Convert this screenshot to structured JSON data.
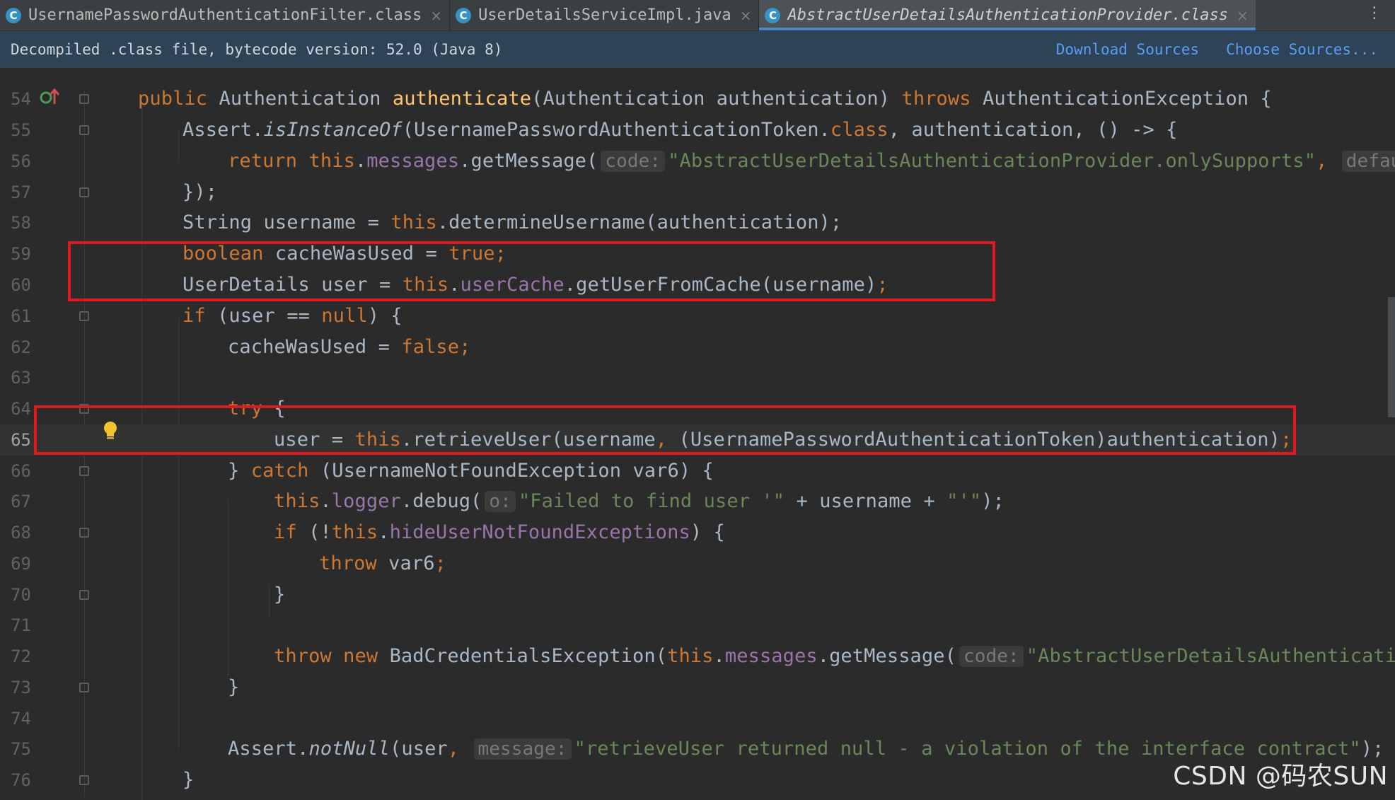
{
  "tabs": [
    {
      "icon": "C",
      "label": "UsernamePasswordAuthenticationFilter.class",
      "close": "×"
    },
    {
      "icon": "C",
      "label": "UserDetailsServiceImpl.java",
      "close": "×"
    },
    {
      "icon": "C",
      "label": "AbstractUserDetailsAuthenticationProvider.class",
      "close": "×"
    }
  ],
  "tabbar_more": "⋮",
  "banner": {
    "text": "Decompiled .class file, bytecode version: 52.0 (Java 8)",
    "download_sources": "Download Sources",
    "choose_sources": "Choose Sources..."
  },
  "editor": {
    "current_line": "65",
    "lines": [
      {
        "n": "54"
      },
      {
        "n": "55"
      },
      {
        "n": "56"
      },
      {
        "n": "57"
      },
      {
        "n": "58"
      },
      {
        "n": "59"
      },
      {
        "n": "60"
      },
      {
        "n": "61"
      },
      {
        "n": "62"
      },
      {
        "n": "63"
      },
      {
        "n": "64"
      },
      {
        "n": "65"
      },
      {
        "n": "66"
      },
      {
        "n": "67"
      },
      {
        "n": "68"
      },
      {
        "n": "69"
      },
      {
        "n": "70"
      },
      {
        "n": "71"
      },
      {
        "n": "72"
      },
      {
        "n": "73"
      },
      {
        "n": "74"
      },
      {
        "n": "75"
      },
      {
        "n": "76"
      }
    ],
    "code": {
      "l54": {
        "t1": "public ",
        "t2": "Authentication ",
        "t3": "authenticate",
        "t4": "(Authentication authentication) ",
        "t5": "throws ",
        "t6": "AuthenticationException {"
      },
      "l55": {
        "t1": "Assert.",
        "t2": "isInstanceOf",
        "t3": "(UsernamePasswordAuthenticationToken.",
        "t4": "class",
        "t5": ", authentication, () -> {"
      },
      "l56": {
        "t1": "return ",
        "t2": "this",
        "t3": ".",
        "t4": "messages",
        "t5": ".getMessage(",
        "hint1": "code:",
        "t6": "\"AbstractUserDetailsAuthenticationProvider.onlySupports\"",
        "t7": ", ",
        "hint2": "defaul"
      },
      "l57": {
        "t1": "});"
      },
      "l58": {
        "t1": "String username = ",
        "t2": "this",
        "t3": ".determineUsername(authentication);"
      },
      "l59": {
        "t1": "boolean ",
        "t2": "cacheWasUsed = ",
        "t3": "true",
        "t4": ";"
      },
      "l60": {
        "t1": "UserDetails user = ",
        "t2": "this",
        "t3": ".",
        "t4": "userCache",
        "t5": ".getUserFromCache(username)",
        "t6": ";"
      },
      "l61": {
        "t1": "if ",
        "t2": "(user == ",
        "t3": "null",
        "t4": ") {"
      },
      "l62": {
        "t1": "cacheWasUsed = ",
        "t2": "false",
        "t3": ";"
      },
      "l64": {
        "t1": "try ",
        "t2": "{"
      },
      "l65": {
        "t1": "user = ",
        "t2": "this",
        "t3": ".retrieveUser(username",
        "t4": ", ",
        "t5": "(UsernamePasswordAuthenticationToken)authentication)",
        "t6": ";"
      },
      "l66": {
        "t1": "} ",
        "t2": "catch ",
        "t3": "(UsernameNotFoundException var6) {"
      },
      "l67": {
        "t1": "this",
        "t2": ".",
        "t3": "logger",
        "t4": ".debug(",
        "hint1": "o:",
        "t5": "\"Failed to find user '\"",
        "t6": " + username + ",
        "t7": "\"'\"",
        "t8": ");"
      },
      "l68": {
        "t1": "if ",
        "t2": "(!",
        "t3": "this",
        "t4": ".",
        "t5": "hideUserNotFoundExceptions",
        "t6": ") {"
      },
      "l69": {
        "t1": "throw ",
        "t2": "var6",
        "t3": ";"
      },
      "l70": {
        "t1": "}"
      },
      "l72": {
        "t1": "throw new ",
        "t2": "BadCredentialsException(",
        "t3": "this",
        "t4": ".",
        "t5": "messages",
        "t6": ".getMessage(",
        "hint1": "code:",
        "t7": "\"AbstractUserDetailsAuthenticatio"
      },
      "l73": {
        "t1": "}"
      },
      "l75": {
        "t1": "Assert.",
        "t2": "notNull",
        "t3": "(user",
        "t4": ", ",
        "hint1": "message:",
        "t5": "\"retrieveUser returned null - a violation of the interface contract\"",
        "t6": ");"
      },
      "l76": {
        "t1": "}"
      }
    }
  },
  "watermark": "CSDN @码农SUN",
  "icons": {
    "override": "override-implements-icon",
    "bulb": "lightbulb-icon"
  },
  "colors": {
    "keyword": "#cc7832",
    "method": "#ffc66d",
    "field": "#9876aa",
    "string": "#6a8759",
    "highlight_box": "#e0191f",
    "link": "#589df6"
  }
}
